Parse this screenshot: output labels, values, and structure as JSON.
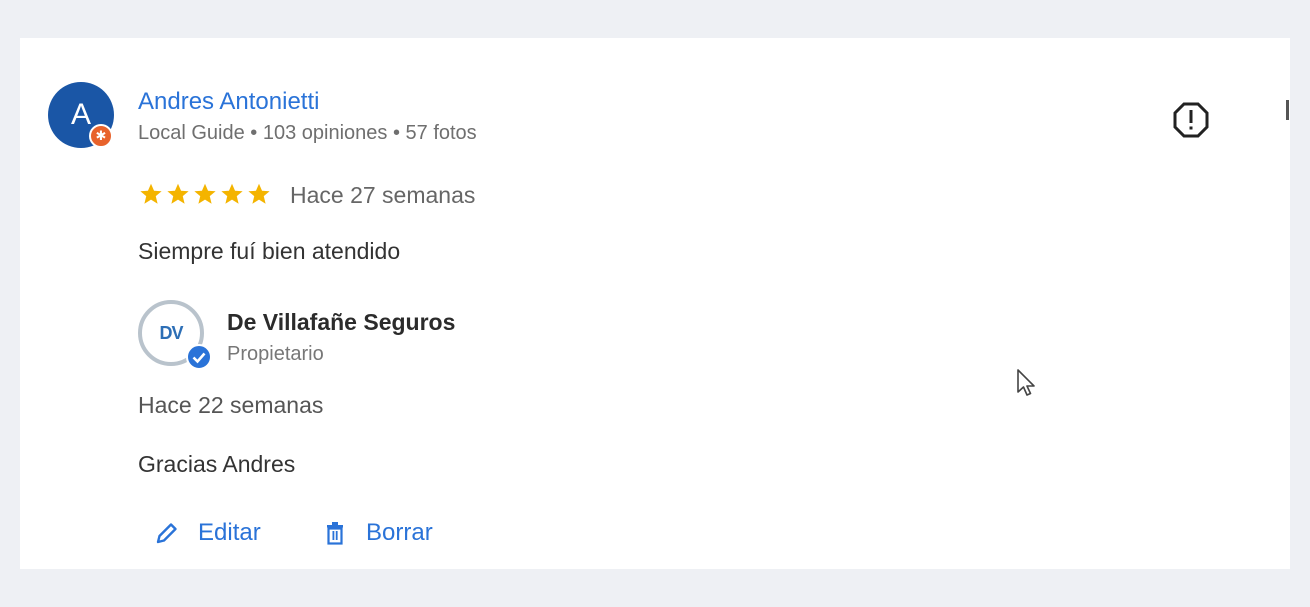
{
  "review": {
    "avatar_letter": "A",
    "author": "Andres Antonietti",
    "author_meta": "Local Guide • 103 opiniones • 57 fotos",
    "rating": 5,
    "rating_max": 5,
    "date": "Hace 27 semanas",
    "text": "Siempre fuí bien atendido"
  },
  "owner_reply": {
    "logo_text": "DV",
    "name": "De Villafañe Seguros",
    "role": "Propietario",
    "date": "Hace 22 semanas",
    "text": "Gracias Andres"
  },
  "actions": {
    "edit_label": "Editar",
    "delete_label": "Borrar"
  },
  "icons": {
    "report": "report-exclamation-icon",
    "edit": "pencil-icon",
    "delete": "trash-icon",
    "verified": "verified-check-icon",
    "local_guide": "local-guide-badge-icon"
  },
  "colors": {
    "link_blue": "#2a73d8",
    "star_gold": "#f4b400",
    "avatar_blue": "#1a56a6",
    "badge_orange": "#e8632c"
  }
}
